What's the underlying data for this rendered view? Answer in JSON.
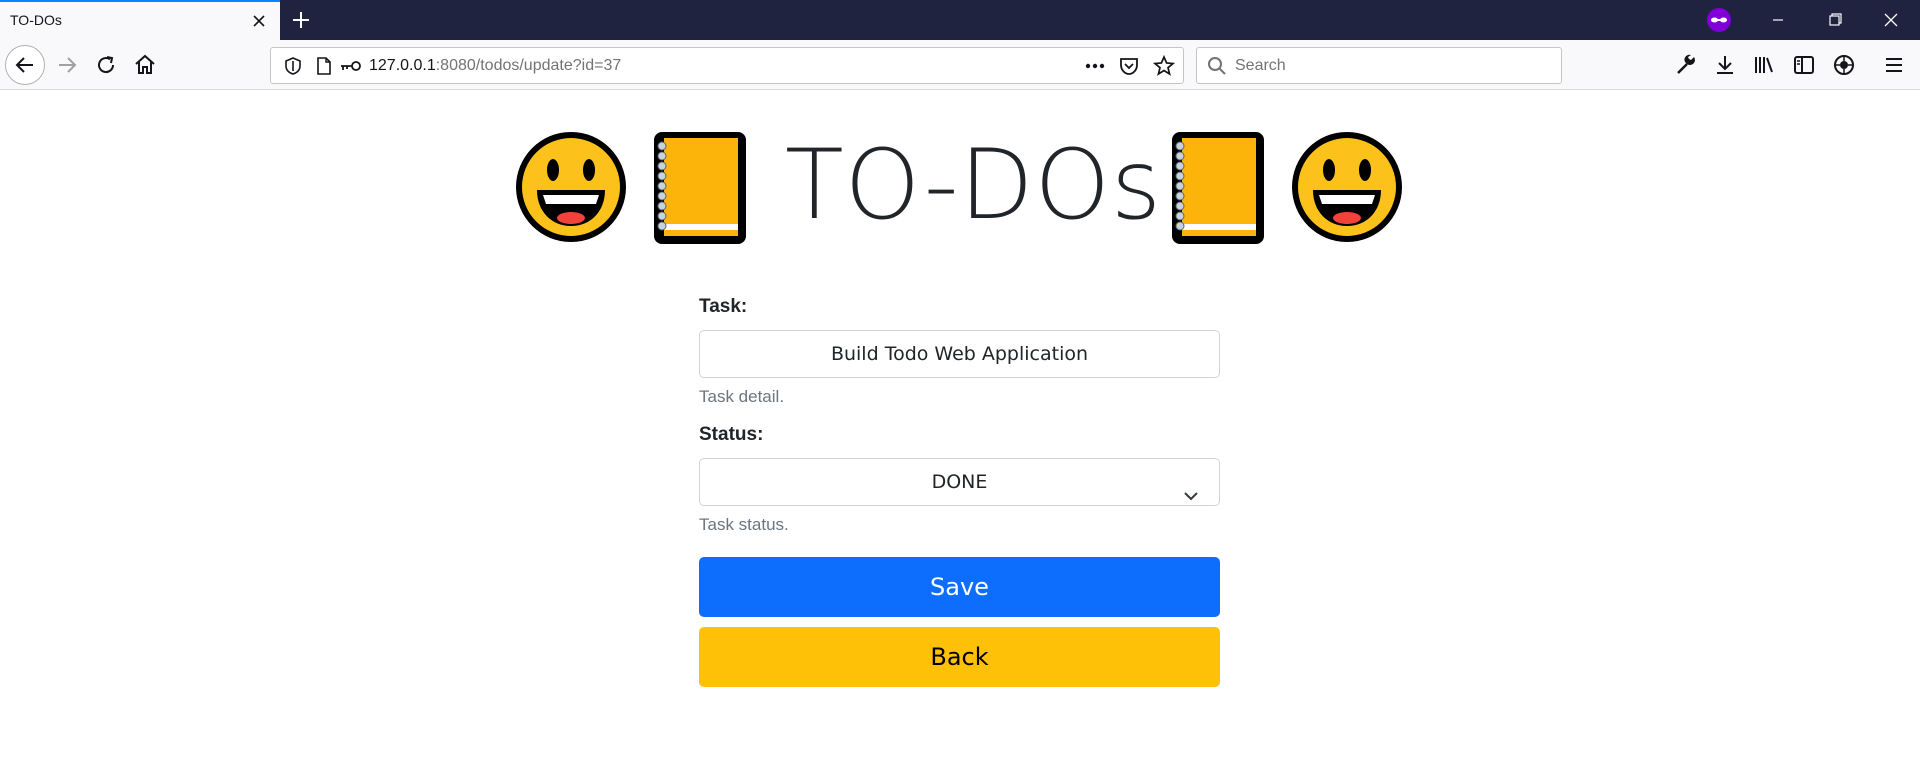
{
  "browser": {
    "tab_title": "TO-DOs",
    "url_host": "127.0.0.1",
    "url_rest": ":8080/todos/update?id=37",
    "search_placeholder": "Search",
    "accent_color": "#0a84ff",
    "private_icon_color": "#8000d7"
  },
  "page": {
    "title": "TO-DOs",
    "left_emojis": [
      "grinning-face-icon",
      "notebook-icon"
    ],
    "right_emojis": [
      "notebook-icon",
      "grinning-face-icon"
    ]
  },
  "form": {
    "task_label": "Task:",
    "task_value": "Build Todo Web Application",
    "task_help": "Task detail.",
    "status_label": "Status:",
    "status_value": "DONE",
    "status_help": "Task status.",
    "save_label": "Save",
    "back_label": "Back",
    "save_color": "#0d6efd",
    "back_color": "#ffc107"
  }
}
